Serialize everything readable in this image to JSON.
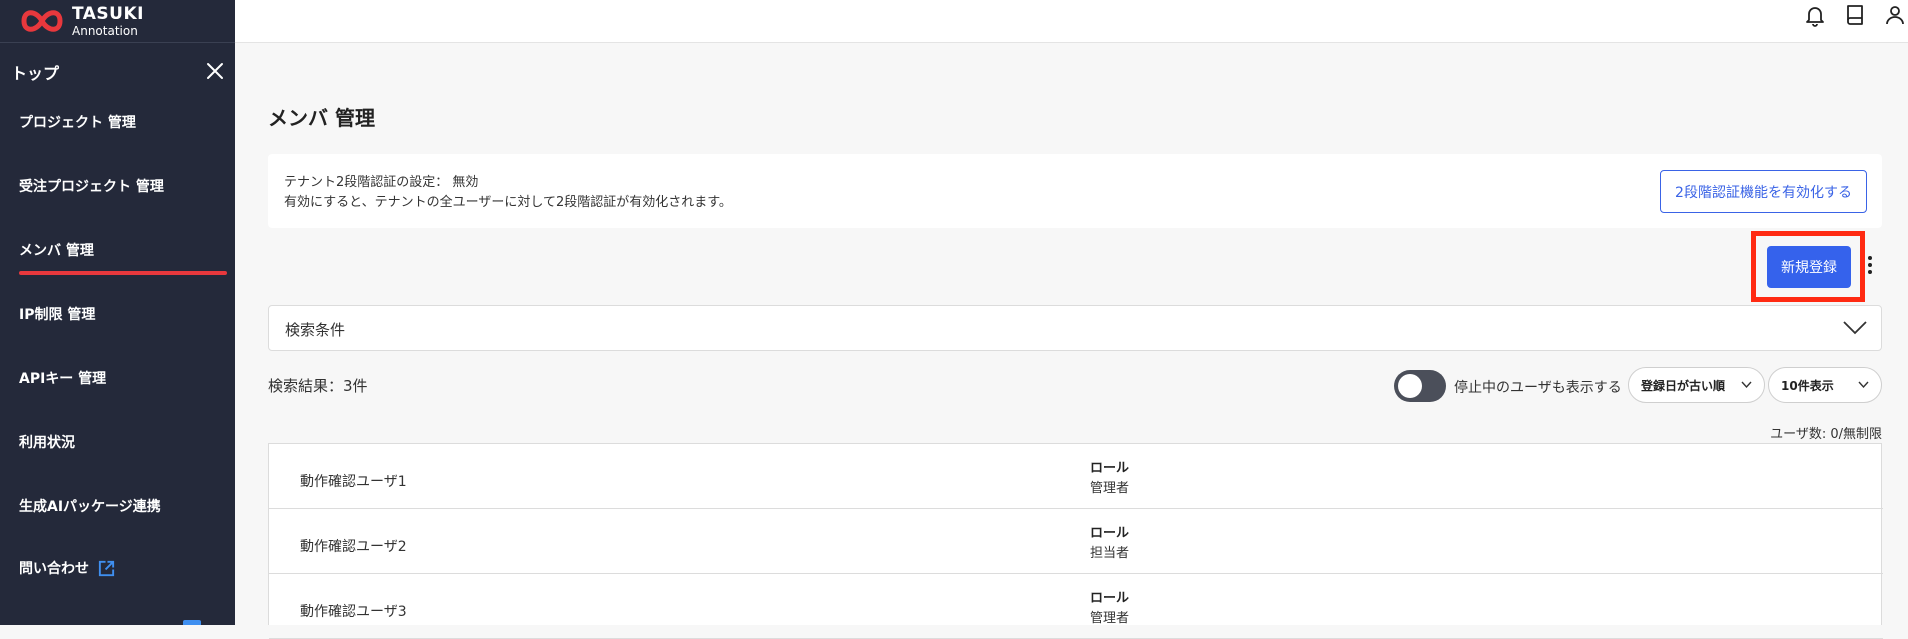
{
  "brand": {
    "name": "TASUKI",
    "sub": "Annotation"
  },
  "sidebar": {
    "top_label": "トップ",
    "items": [
      {
        "label": "プロジェクト 管理"
      },
      {
        "label": "受注プロジェクト 管理"
      },
      {
        "label": "メンバ 管理",
        "active": true
      },
      {
        "label": "IP制限 管理"
      },
      {
        "label": "APIキー 管理"
      },
      {
        "label": "利用状況"
      },
      {
        "label": "生成AIパッケージ連携"
      },
      {
        "label": "問い合わせ",
        "external": true
      }
    ]
  },
  "header": {
    "icons": [
      "bell-icon",
      "book-icon",
      "user-icon"
    ]
  },
  "main": {
    "title": "メンバ 管理",
    "notice": {
      "line1": "テナント2段階認証の設定： 無効",
      "line2": "有効にすると、テナントの全ユーザーに対して2段階認証が有効化されます。",
      "button_label": "2段階認証機能を有効化する"
    },
    "new_button_label": "新規登録",
    "search_label": "検索条件",
    "result_count": "検索結果：3件",
    "toggle_label": "停止中のユーザも表示する",
    "sort_select": "登録日が古い順",
    "page_size_select": "10件表示",
    "user_count": "ユーザ数: 0/無制限",
    "role_header": "ロール",
    "rows": [
      {
        "name": "動作確認ユーザ1",
        "role": "管理者"
      },
      {
        "name": "動作確認ユーザ2",
        "role": "担当者"
      },
      {
        "name": "動作確認ユーザ3",
        "role": "管理者"
      }
    ]
  },
  "colors": {
    "sidebar_bg": "#24293a",
    "accent": "#3562ec",
    "active_underline": "#e8383d",
    "highlight": "#ff2a12"
  }
}
